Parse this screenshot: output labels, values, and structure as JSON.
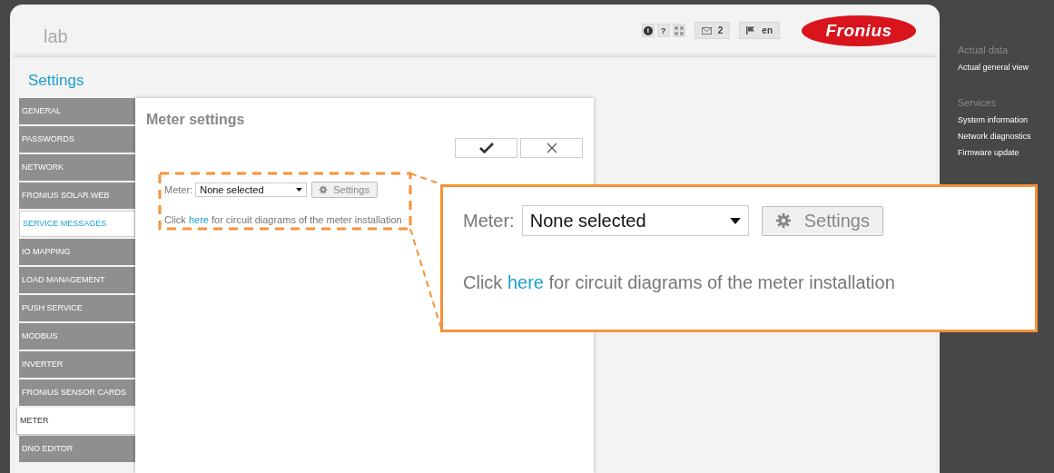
{
  "header": {
    "site": "lab",
    "toolbar": {
      "info": "i",
      "help": "?",
      "messages": "2",
      "language": "en"
    },
    "logo": "Fronius"
  },
  "page_title": "Settings",
  "menu": [
    {
      "label": "GENERAL",
      "selected": false,
      "highlighted": false
    },
    {
      "label": "PASSWORDS",
      "selected": false,
      "highlighted": false
    },
    {
      "label": "NETWORK",
      "selected": false,
      "highlighted": false
    },
    {
      "label": "FRONIUS SOLAR.WEB",
      "selected": false,
      "highlighted": false
    },
    {
      "label": "SERVICE MESSAGES",
      "selected": false,
      "highlighted": true
    },
    {
      "label": "IO MAPPING",
      "selected": false,
      "highlighted": false
    },
    {
      "label": "LOAD MANAGEMENT",
      "selected": false,
      "highlighted": false
    },
    {
      "label": "PUSH SERVICE",
      "selected": false,
      "highlighted": false
    },
    {
      "label": "MODBUS",
      "selected": false,
      "highlighted": false
    },
    {
      "label": "INVERTER",
      "selected": false,
      "highlighted": false
    },
    {
      "label": "FRONIUS SENSOR CARDS",
      "selected": false,
      "highlighted": false
    },
    {
      "label": "METER",
      "selected": true,
      "highlighted": false
    },
    {
      "label": "DNO EDITOR",
      "selected": false,
      "highlighted": false
    }
  ],
  "panel": {
    "title": "Meter settings",
    "meter_label": "Meter:",
    "meter_select": "None selected",
    "settings_button": "Settings",
    "hint_parts": [
      "Click",
      "here",
      "for circuit diagrams of the meter installation"
    ]
  },
  "callout": {
    "meter_label": "Meter:",
    "meter_select": "None selected",
    "settings_button": "Settings",
    "hint_parts": [
      "Click",
      "here",
      "for circuit diagrams of the meter installation"
    ]
  },
  "sidebar": [
    {
      "heading": "Actual data",
      "items": [
        "Actual general view"
      ]
    },
    {
      "heading": "Services",
      "items": [
        "System information",
        "Network diagnostics",
        "Firmware update"
      ]
    }
  ]
}
